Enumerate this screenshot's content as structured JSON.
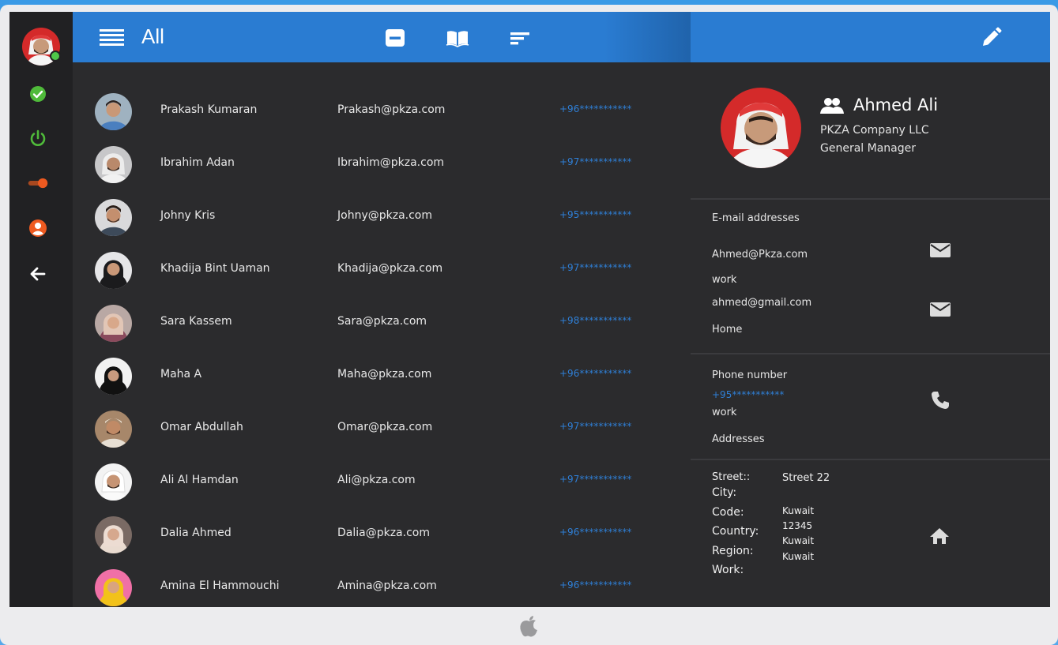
{
  "header": {
    "filter_label": "All",
    "accent_color": "#2a7cd2"
  },
  "rail": {
    "icons": [
      "check-circle-icon",
      "power-icon",
      "toggle-icon",
      "user-circle-icon",
      "arrow-left-icon"
    ],
    "status_color": "#4fc64a"
  },
  "toolbar": {
    "icons": [
      "minus-square-icon",
      "open-book-icon",
      "sort-icon",
      "pencil-icon"
    ]
  },
  "contacts": [
    {
      "name": "Prakash Kumaran",
      "email": "Prakash@pkza.com",
      "phone": "+96***********"
    },
    {
      "name": "Ibrahim Adan",
      "email": "Ibrahim@pkza.com",
      "phone": "+97***********"
    },
    {
      "name": "Johny Kris",
      "email": "Johny@pkza.com",
      "phone": "+95***********"
    },
    {
      "name": "Khadija Bint Uaman",
      "email": "Khadija@pkza.com",
      "phone": "+97***********"
    },
    {
      "name": "Sara Kassem",
      "email": "Sara@pkza.com",
      "phone": "+98***********"
    },
    {
      "name": "Maha A",
      "email": "Maha@pkza.com",
      "phone": "+96***********"
    },
    {
      "name": "Omar Abdullah",
      "email": "Omar@pkza.com",
      "phone": "+97***********"
    },
    {
      "name": "Ali Al Hamdan",
      "email": "Ali@pkza.com",
      "phone": "+97***********"
    },
    {
      "name": "Dalia Ahmed",
      "email": "Dalia@pkza.com",
      "phone": "+96***********"
    },
    {
      "name": "Amina El Hammouchi",
      "email": "Amina@pkza.com",
      "phone": "+96***********"
    }
  ],
  "detail": {
    "name": "Ahmed Ali",
    "company": "PKZA Company LLC",
    "role": "General Manager",
    "email_section_title": "E-mail addresses",
    "emails": [
      {
        "address": "Ahmed@Pkza.com",
        "type": "work"
      },
      {
        "address": "ahmed@gmail.com",
        "type": "Home"
      }
    ],
    "phone_section_title": "Phone number",
    "phone": {
      "number": "+95***********",
      "type": "work"
    },
    "address_section_title": "Addresses",
    "address_labels": [
      "Street::",
      "City:",
      "Code:",
      "Country:",
      "Region:",
      "Work:"
    ],
    "address_values": [
      "Street 22",
      "Kuwait",
      "12345",
      "Kuwait",
      "Kuwait"
    ]
  }
}
